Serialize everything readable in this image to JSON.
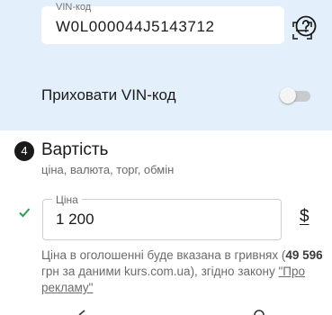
{
  "vin": {
    "label": "VIN-код",
    "value": "W0L000044J5143712",
    "scan_icon": "scan-frame-icon",
    "help_icon": "question-circle-icon"
  },
  "hide_vin": {
    "label": "Приховати VIN-код",
    "enabled": false
  },
  "price_section": {
    "step_number": "4",
    "title": "Вартість",
    "subtitle": "ціна, валюта, торг, обмін",
    "status_icon": "check-icon",
    "price_label": "Ціна",
    "price_value": "1 200",
    "currency_symbol": "$",
    "note_part1": "Ціна в оголошенні буде вказана в гривнях (",
    "note_bold": "49 596",
    "note_part2": " грн за даними kurs.com.ua), згідно закону ",
    "note_link": "\"Про рекламу\""
  },
  "colors": {
    "vin_background": "#e3f0fb",
    "check_green": "#2e9e4f",
    "badge": "#1a1a1a"
  }
}
